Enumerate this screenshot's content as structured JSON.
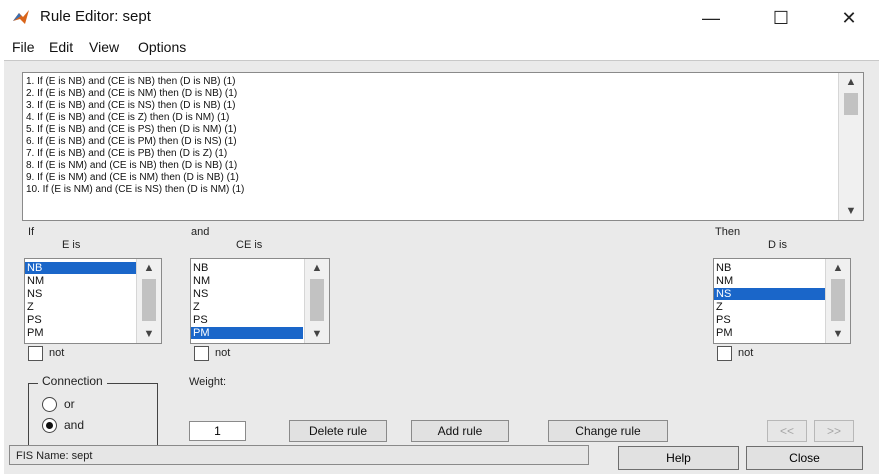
{
  "window": {
    "title": "Rule Editor: sept",
    "minimize": "—",
    "maximize": "☐",
    "close": "✕"
  },
  "menu": [
    "File",
    "Edit",
    "View",
    "Options"
  ],
  "rules": [
    "1. If (E is NB) and (CE is NB) then (D is NB) (1)",
    "2. If (E is NB) and (CE is NM) then (D is NB) (1)",
    "3. If (E is NB) and (CE is NS) then (D is NB) (1)",
    "4. If (E is NB) and (CE is Z) then (D is NM) (1)",
    "5. If (E is NB) and (CE is PS) then (D is NM) (1)",
    "6. If (E is NB) and (CE is PM) then (D is NS) (1)",
    "7. If (E is NB) and (CE is PB) then (D is Z) (1)",
    "8. If (E is NM) and (CE is NB) then (D is NB) (1)",
    "9. If (E is NM) and (CE is NM) then (D is NB) (1)",
    "10. If (E is NM) and (CE is NS) then (D is NM) (1)"
  ],
  "selected_rule_index": 5,
  "labels": {
    "if": "If",
    "e_is": "E is",
    "and": "and",
    "ce_is": "CE is",
    "then": "Then",
    "d_is": "D is",
    "not": "not",
    "connection": "Connection",
    "or": "or",
    "and_option": "and",
    "weight": "Weight:"
  },
  "e_options": [
    "NB",
    "NM",
    "NS",
    "Z",
    "PS",
    "PM"
  ],
  "e_selected": 0,
  "ce_options": [
    "NB",
    "NM",
    "NS",
    "Z",
    "PS",
    "PM"
  ],
  "ce_selected": 5,
  "d_options": [
    "NB",
    "NM",
    "NS",
    "Z",
    "PS",
    "PM"
  ],
  "d_selected": 2,
  "connection_selected": "and",
  "weight_value": "1",
  "buttons": {
    "delete_rule": "Delete rule",
    "add_rule": "Add rule",
    "change_rule": "Change rule",
    "prev": "<<",
    "next": ">>",
    "help": "Help",
    "close": "Close"
  },
  "status": "FIS Name: sept",
  "colors": {
    "selection": "#1a66c9"
  }
}
